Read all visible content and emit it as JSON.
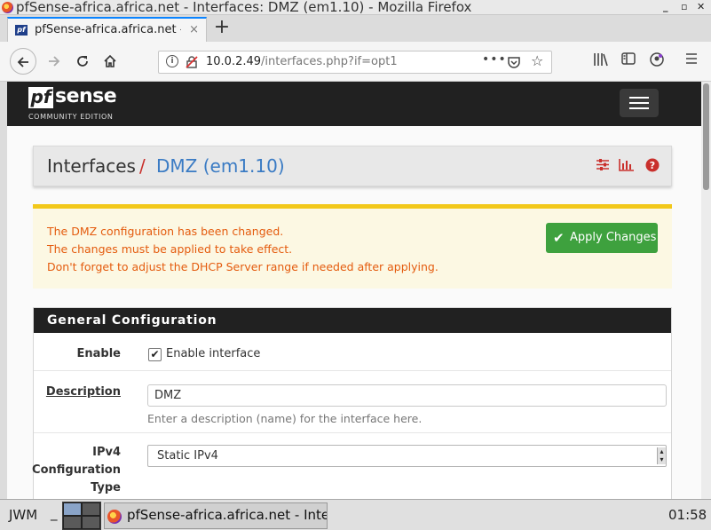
{
  "window": {
    "title": "pfSense-africa.africa.net - Interfaces: DMZ (em1.10) - Mozilla Firefox",
    "min_glyph": "_",
    "max_glyph": "▫",
    "close_glyph": "✕"
  },
  "browser": {
    "tab_label": "pfSense-africa.africa.net - Interfaces: DMZ",
    "tab_close": "×",
    "new_tab": "+",
    "url_host": "10.0.2.49",
    "url_path": "/interfaces.php?if=opt1",
    "more_dots": "•••",
    "icons": [
      "back-icon",
      "forward-icon",
      "reload-icon",
      "home-icon",
      "info-icon",
      "insecure-lock-icon",
      "more-icon",
      "pocket-icon",
      "bookmark-star-icon",
      "library-icon",
      "sidebar-icon",
      "account-icon",
      "menu-icon"
    ]
  },
  "pfsense": {
    "logo_pf": "pf",
    "logo_sense": "sense",
    "logo_edition": "COMMUNITY EDITION",
    "breadcrumb_root": "Interfaces",
    "breadcrumb_sep": "/",
    "breadcrumb_current": "DMZ (em1.10)",
    "accent_red": "#c9302c",
    "link_blue": "#3a7bc4"
  },
  "alert": {
    "line1": "The DMZ configuration has been changed.",
    "line2": "The changes must be applied to take effect.",
    "line3": "Don't forget to adjust the DHCP Server range if needed after applying.",
    "apply_label": "Apply Changes",
    "text_color": "#e45b0e",
    "button_color": "#3ea13e"
  },
  "general": {
    "heading": "General Configuration",
    "enable_label": "Enable",
    "enable_checked": true,
    "enable_text": "Enable interface",
    "description_label": "Description",
    "description_value": "DMZ",
    "description_help": "Enter a description (name) for the interface here.",
    "ipv4_label_1": "IPv4",
    "ipv4_label_2": "Configuration",
    "ipv4_label_3": "Type",
    "ipv4_value": "Static IPv4"
  },
  "taskbar": {
    "wm": "JWM",
    "underscore": "_",
    "task_title": "pfSense-africa.africa.net - Interfaces: DMZ",
    "clock": "01:58"
  }
}
